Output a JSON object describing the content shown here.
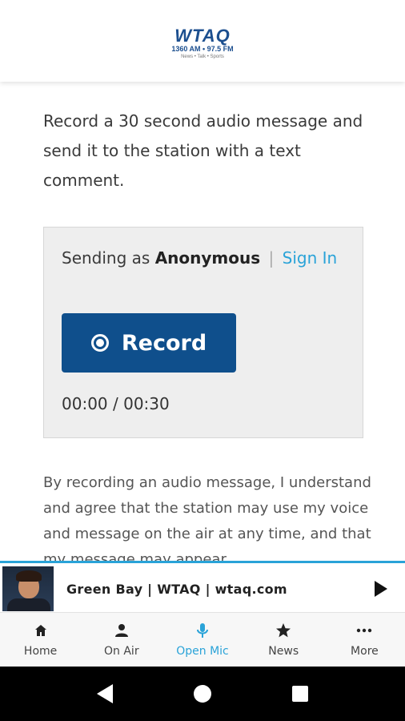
{
  "header": {
    "logo_main": "WTAQ",
    "logo_freq": "1360 AM • 97.5 FM",
    "logo_tagline": "News • Talk • Sports"
  },
  "intro_text": "Record a 30 second audio message and send it to the station with a text comment.",
  "card": {
    "sending_prefix": "Sending as",
    "sending_name": "Anonymous",
    "separator": "|",
    "sign_in_label": "Sign In",
    "record_label": "Record",
    "timer": "00:00 / 00:30"
  },
  "disclaimer": "By recording an audio message, I understand and agree that the station may use my voice and message on the air at any time, and that my message may appear",
  "player": {
    "title": "Green Bay | WTAQ | wtaq.com"
  },
  "tabs": [
    {
      "label": "Home",
      "icon": "home-icon"
    },
    {
      "label": "On Air",
      "icon": "person-icon"
    },
    {
      "label": "Open Mic",
      "icon": "microphone-icon"
    },
    {
      "label": "News",
      "icon": "star-icon"
    },
    {
      "label": "More",
      "icon": "more-icon"
    }
  ],
  "colors": {
    "brand": "#0f4f8c",
    "accent": "#2aa3d8",
    "card_bg": "#eeeeee"
  }
}
